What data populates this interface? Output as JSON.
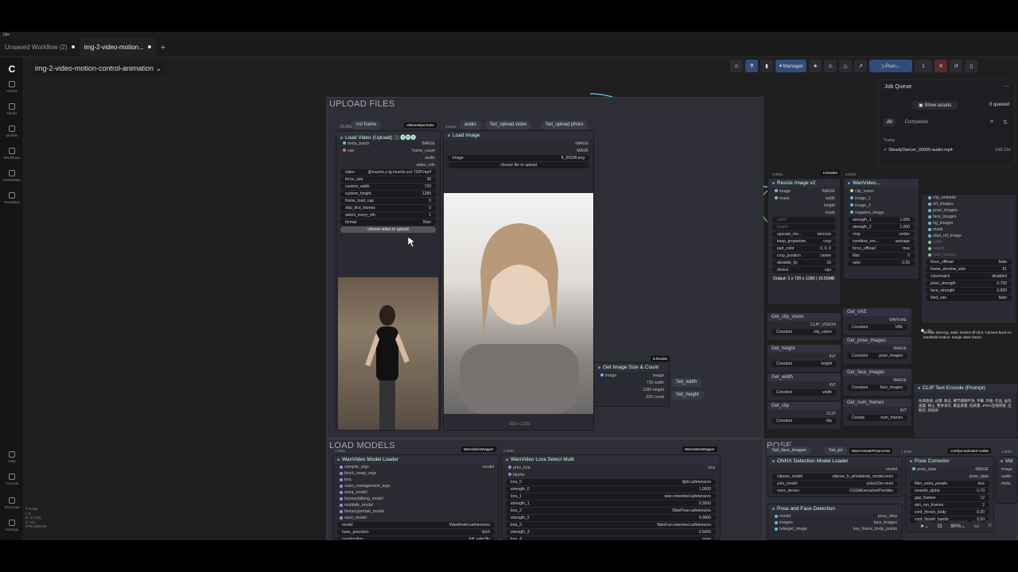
{
  "app": {
    "status": "Idle",
    "tabs": [
      "Unsaved Workflow (2)",
      "img-2-video-motion..."
    ],
    "add_tab": "+",
    "workflow_name": "img-2-video-motion-control-animation"
  },
  "sidebar": [
    {
      "label": "Assets",
      "icon": "image-icon"
    },
    {
      "label": "Nodes",
      "icon": "nodes-icon"
    },
    {
      "label": "Models",
      "icon": "cube-icon"
    },
    {
      "label": "Workflows",
      "icon": "flow-icon"
    },
    {
      "label": "NodesMap",
      "icon": "map-icon"
    },
    {
      "label": "Templates",
      "icon": "template-icon"
    },
    {
      "label": "Help",
      "icon": "help-icon"
    },
    {
      "label": "Console",
      "icon": "console-icon"
    },
    {
      "label": "Shortcuts",
      "icon": "keyboard-icon"
    },
    {
      "label": "Settings",
      "icon": "gear-icon"
    }
  ],
  "stats": [
    "T: 0.00s",
    "I: 0",
    "N: 32 [32]",
    "V: 112",
    "FPS:1000.00"
  ],
  "toolbar": {
    "manager": "Manager",
    "run": "Run",
    "count": "1"
  },
  "job_queue": {
    "title": "Job Queue",
    "show_assets": "Show assets",
    "queued": "0 queued",
    "tab_all": "All",
    "tab_completed": "Completed",
    "today": "Today",
    "item_name": "SteadyDancer_00005-audio.mp4",
    "item_time": "548.33s"
  },
  "zoom": "90%",
  "groups": {
    "upload": "UPLOAD FILES",
    "load_models": "LOAD MODELS",
    "pose": "POSE"
  },
  "upload": {
    "set_first_frame": "irst frame",
    "tag_vhs": "VideoHelperSuite",
    "time1": "23.846s",
    "time2": "0.040s",
    "audio": "audio",
    "set_upload_video": "Set_upload video",
    "set_upload_photo": "Set_upload photo",
    "load_video_title": "Load Video (Upload) 🎥🅥🅗🅢",
    "load_image_title": "Load Image",
    "lv_inputs": [
      "meta_batch",
      "vae"
    ],
    "lv_outputs": [
      "IMAGE",
      "frame_count",
      "audio",
      "video_info"
    ],
    "lv_widgets": [
      [
        "video",
        "@muerto.z.tg muerto.zzz 720P.mp4"
      ],
      [
        "force_rate",
        "30"
      ],
      [
        "custom_width",
        "720"
      ],
      [
        "custom_height",
        "1280"
      ],
      [
        "frame_load_cap",
        "0"
      ],
      [
        "skip_first_frames",
        "0"
      ],
      [
        "select_every_nth",
        "1"
      ],
      [
        "format",
        "Wan"
      ]
    ],
    "choose_video": "choose video to upload",
    "li_outputs": [
      "IMAGE",
      "MASK"
    ],
    "li_image": "image",
    "li_image_val": "ft_00038.png",
    "choose_file": "choose file to upload",
    "img_dims": "832 x 1216",
    "kjnodes": "KJNodes",
    "get_size_title": "Get Image Size & Count",
    "gs_input": "image",
    "gs_outputs": [
      "image",
      "720 width",
      "1280 height",
      "325 count"
    ],
    "set_width": "Set_width",
    "set_height": "Set_height"
  },
  "resize": {
    "time": "0.068s",
    "tag": "KJNodes",
    "time2": "0.500s",
    "title": "Resize Image v2",
    "inputs": [
      "image",
      "mask"
    ],
    "outputs": [
      "IMAGE",
      "width",
      "height",
      "mask"
    ],
    "widgets": [
      [
        "width",
        ""
      ],
      [
        "height",
        ""
      ],
      [
        "upscale_me...",
        "lanczos"
      ],
      [
        "keep_proportion",
        "crop"
      ],
      [
        "pad_color",
        "0, 0, 0"
      ],
      [
        "crop_position",
        "center"
      ],
      [
        "divisible_by",
        "16"
      ],
      [
        "device",
        "cpu"
      ]
    ],
    "output_text": "Output: 1 x 720 x 1280 | 10.55MB"
  },
  "wanvideo_encode": {
    "title": "WanVideo...",
    "inputs": [
      "clip_vision",
      "image_1",
      "image_2",
      "negative_image"
    ],
    "widgets": [
      [
        "strength_1",
        "1.000"
      ],
      [
        "strength_2",
        "1.000"
      ],
      [
        "crop",
        "center"
      ],
      [
        "combine_em...",
        "average"
      ],
      [
        "force_offload",
        "true"
      ],
      [
        "tiles",
        "0"
      ],
      [
        "ratio",
        "0.50"
      ]
    ]
  },
  "embeds": {
    "items": [
      "clip_embeds",
      "ref_images",
      "pose_images",
      "face_images",
      "bg_images",
      "mask",
      "start_ref_image",
      "width",
      "height",
      "num_frames"
    ],
    "widgets": [
      [
        "force_offload",
        "false"
      ],
      [
        "frame_window_size",
        "81"
      ],
      [
        "colormatch",
        "disabled"
      ],
      [
        "pose_strength",
        "0.700"
      ],
      [
        "face_strength",
        "0.600"
      ],
      [
        "tiled_vae",
        "false"
      ]
    ]
  },
  "getters": [
    {
      "title": "Get_clip_vision",
      "out": "CLIP_VISION",
      "k": "Constant",
      "v": "clip_vision"
    },
    {
      "title": "Get_height",
      "out": "INT",
      "k": "Constant",
      "v": "height"
    },
    {
      "title": "Get_width",
      "out": "INT",
      "k": "Constant",
      "v": "width"
    },
    {
      "title": "Get_clip",
      "out": "CLIP",
      "k": "Constant",
      "v": "clip"
    },
    {
      "title": "Get_VAE",
      "out": "WANVAE",
      "k": "Constant",
      "v": "VAE"
    },
    {
      "title": "Get_pose_images",
      "out": "IMAGE",
      "k": "Constant",
      "v": "pose_images"
    },
    {
      "title": "Get_face_images",
      "out": "IMAGE",
      "k": "Constant",
      "v": "face_images"
    },
    {
      "title": "Get_num_frames",
      "out": "INT",
      "k": "Consta",
      "v": "num_frames"
    }
  ],
  "prompt": {
    "clip": "clip",
    "positive": "woman dancing, static locked-off shot. Camera fixed no handheld motion. Single static frame.",
    "title": "CLIP Text Encode (Prompt)",
    "negative": "色调艳丽, 过曝, 静态, 细节模糊不清, 字幕, 风格, 作品, 画作, 画面, 静止, 整体发灰, 最差质量, 低质量, JPEG压缩残留, 丑陋的, 残缺的"
  },
  "load_models": {
    "time": "1.985s",
    "tag1": "WanVideoWrapper",
    "time2": "0.009s",
    "tag2": "WanVideoWrapper",
    "loader_title": "WanVideo Model Loader",
    "loader_inputs": [
      "compile_args",
      "block_swap_args",
      "lora",
      "vram_management_args",
      "extra_model",
      "fantasytalking_model",
      "multitalk_model",
      "fantasyportrait_model",
      "vace_model"
    ],
    "loader_out": "model",
    "loader_widgets": [
      [
        "model",
        "WanModel.safetensors"
      ],
      [
        "base_precision",
        "fp16"
      ],
      [
        "quantization",
        "fp8_e4m3fn"
      ],
      [
        "load_device",
        "offload_device"
      ],
      [
        "attention_mode",
        "sdpa"
      ]
    ],
    "lora_title": "WanVideo Lora Select Multi",
    "lora_inputs": [
      "prev_lora",
      "blocks"
    ],
    "lora_out": "lora",
    "lora_widgets": [
      [
        "lora_0",
        "light.safetensors"
      ],
      [
        "strength_0",
        "1.0000"
      ],
      [
        "lora_1",
        "wan.reworked.safetensors"
      ],
      [
        "strength_1",
        "0.3000"
      ],
      [
        "lora_2",
        "WanPose.safetensors"
      ],
      [
        "strength_2",
        "0.9000"
      ],
      [
        "lora_3",
        "WanFun.reworked.safetensors"
      ],
      [
        "strength_3",
        "0.5000"
      ],
      [
        "lora_4",
        "none"
      ],
      [
        "strength_4",
        "0.0000"
      ]
    ]
  },
  "pose": {
    "set_face": "Set_face_images",
    "set_po": "Set_po",
    "tag1": "WanAnimatePreprocess",
    "time1": "1.936s",
    "tag2": "comfyui-animator-nodes",
    "time2": "1.509s",
    "onnx_title": "ONNX Detection Model Loader",
    "onnx_out": "model",
    "onnx_widgets": [
      [
        "vitpose_model",
        "vitpose_h_wholebody_model.onnx"
      ],
      [
        "yolo_model",
        "yolov10m.onnx"
      ],
      [
        "onnx_device",
        "CUDAExecutionProvider"
      ]
    ],
    "pfd_title": "Pose and Face Detection",
    "pfd_inputs": [
      "model",
      "images",
      "retarget_image"
    ],
    "pfd_outputs": [
      "pose_data",
      "face_images",
      "key_frame_body_points",
      "bboxes",
      "face_bboxes"
    ],
    "pfd_widgets": [
      "width",
      "height"
    ],
    "corrector_title": "Pose Corrector",
    "corrector_inputs": [
      "pose_data"
    ],
    "corrector_outputs": [
      "IMAGE",
      "pose_data"
    ],
    "corrector_widgets": [
      [
        "filter_extra_people",
        "true"
      ],
      [
        "smooth_alpha",
        "0.70"
      ],
      [
        "gap_frames",
        "12"
      ],
      [
        "min_run_frames",
        "2"
      ],
      [
        "conf_thresh_body",
        "0.20"
      ],
      [
        "conf_thresh_hands",
        "0.50"
      ]
    ],
    "vid": "Vid",
    "vid_items": [
      "image",
      "audio",
      "meta"
    ]
  }
}
